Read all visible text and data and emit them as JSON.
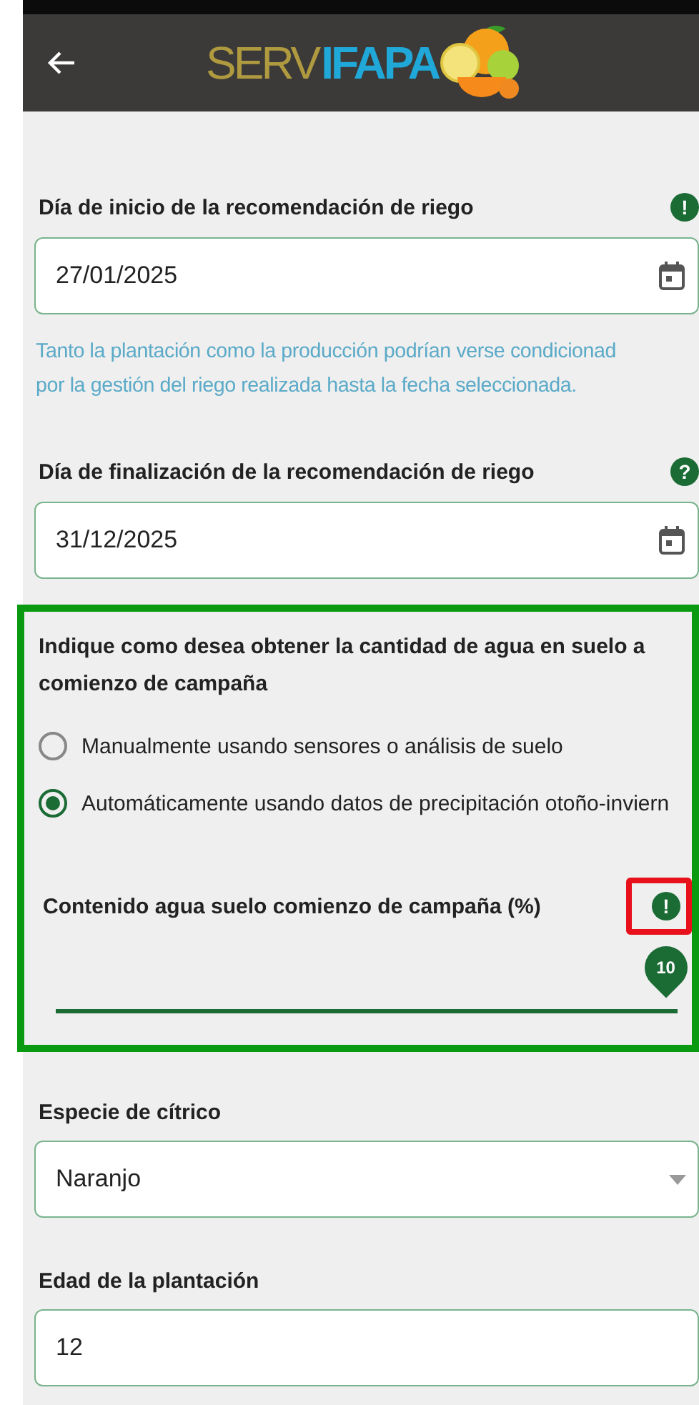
{
  "header": {
    "logo_left": "SERV",
    "logo_right": "IFAPA"
  },
  "start_date": {
    "label": "Día de inicio de la recomendación de riego",
    "help": "!",
    "value": "27/01/2025"
  },
  "start_hint": "Tanto la plantación como la producción podrían verse condicionad\npor la gestión del riego realizada hasta la fecha seleccionada.",
  "end_date": {
    "label": "Día de finalización de la recomendación de riego",
    "help": "?",
    "value": "31/12/2025"
  },
  "water_method": {
    "title": "Indique como desea obtener la cantidad de agua en suelo a comienzo de campaña",
    "options": [
      {
        "label": "Manualmente usando sensores o análisis de suelo",
        "selected": false
      },
      {
        "label": "Automáticamente usando datos de precipitación otoño-inviern",
        "selected": true
      }
    ],
    "soil_water": {
      "label": "Contenido agua suelo comienzo de campaña (%)",
      "help": "!",
      "reading": "10",
      "level": 1
    }
  },
  "species": {
    "label": "Especie de cítrico",
    "value": "Naranjo"
  },
  "age": {
    "label": "Edad de la plantación",
    "value": "12"
  }
}
